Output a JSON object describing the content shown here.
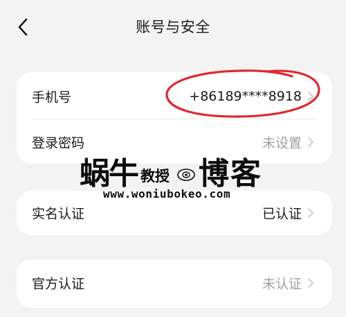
{
  "header": {
    "title": "账号与安全",
    "back_icon": "chevron-left-icon"
  },
  "account_card": {
    "phone": {
      "label": "手机号",
      "value": "+86189****8918"
    },
    "password": {
      "label": "登录密码",
      "value": "未设置"
    }
  },
  "realname_card": {
    "label": "实名认证",
    "value": "已认证"
  },
  "official_card": {
    "label": "官方认证",
    "value": "未认证"
  },
  "annotation": {
    "color": "#e0282e",
    "shape": "hand-drawn-ellipse"
  },
  "watermark": {
    "name_part_1": "蜗牛",
    "name_part_2": "教授",
    "name_part_3": "博客",
    "url": "www.woniubokeo.com"
  },
  "colors": {
    "background": "#f3f3f3",
    "card": "#ffffff",
    "text_primary": "#1a1a1a",
    "text_muted": "#a0a0a0",
    "chevron": "#c4c4c4"
  }
}
